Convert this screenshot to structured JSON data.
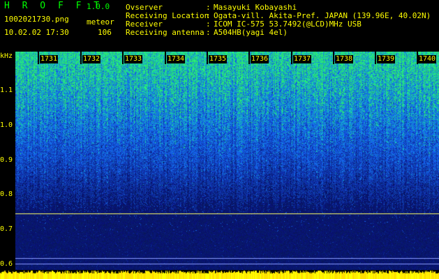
{
  "header": {
    "brand": "H R O F F T",
    "version": "1.0.0",
    "filename": "1002021730.png",
    "mode": "meteor",
    "datetime": "10.02.02 17:30",
    "count": "106",
    "fields": [
      {
        "label": "Ovserver",
        "sep": ":",
        "value": "Masayuki Kobayashi"
      },
      {
        "label": "Receiving Location",
        "sep": ":",
        "value": "Ogata-vill. Akita-Pref. JAPAN (139.96E, 40.02N)"
      },
      {
        "label": "Receiver",
        "sep": ":",
        "value": "ICOM IC-575 53.7492(@LCD)MHz USB"
      },
      {
        "label": "Receiving antenna",
        "sep": ":",
        "value": "A504HB(yagi 4el)"
      }
    ]
  },
  "y_axis": {
    "unit": "kHz",
    "ticks": [
      "1.1",
      "1.0",
      "0.9",
      "0.8",
      "0.7",
      "0.6"
    ]
  },
  "x_axis": {
    "ticks": [
      "1731",
      "1732",
      "1733",
      "1734",
      "1735",
      "1736",
      "1737",
      "1738",
      "1739",
      "1740"
    ]
  },
  "colors": {
    "background": "#000000",
    "text": "#ffff00",
    "brand": "#00ff00",
    "signal_line": "#ffff66",
    "spectrum_low": "#0a1a6a",
    "spectrum_mid": "#1e5aff",
    "spectrum_high": "#28d27a"
  }
}
